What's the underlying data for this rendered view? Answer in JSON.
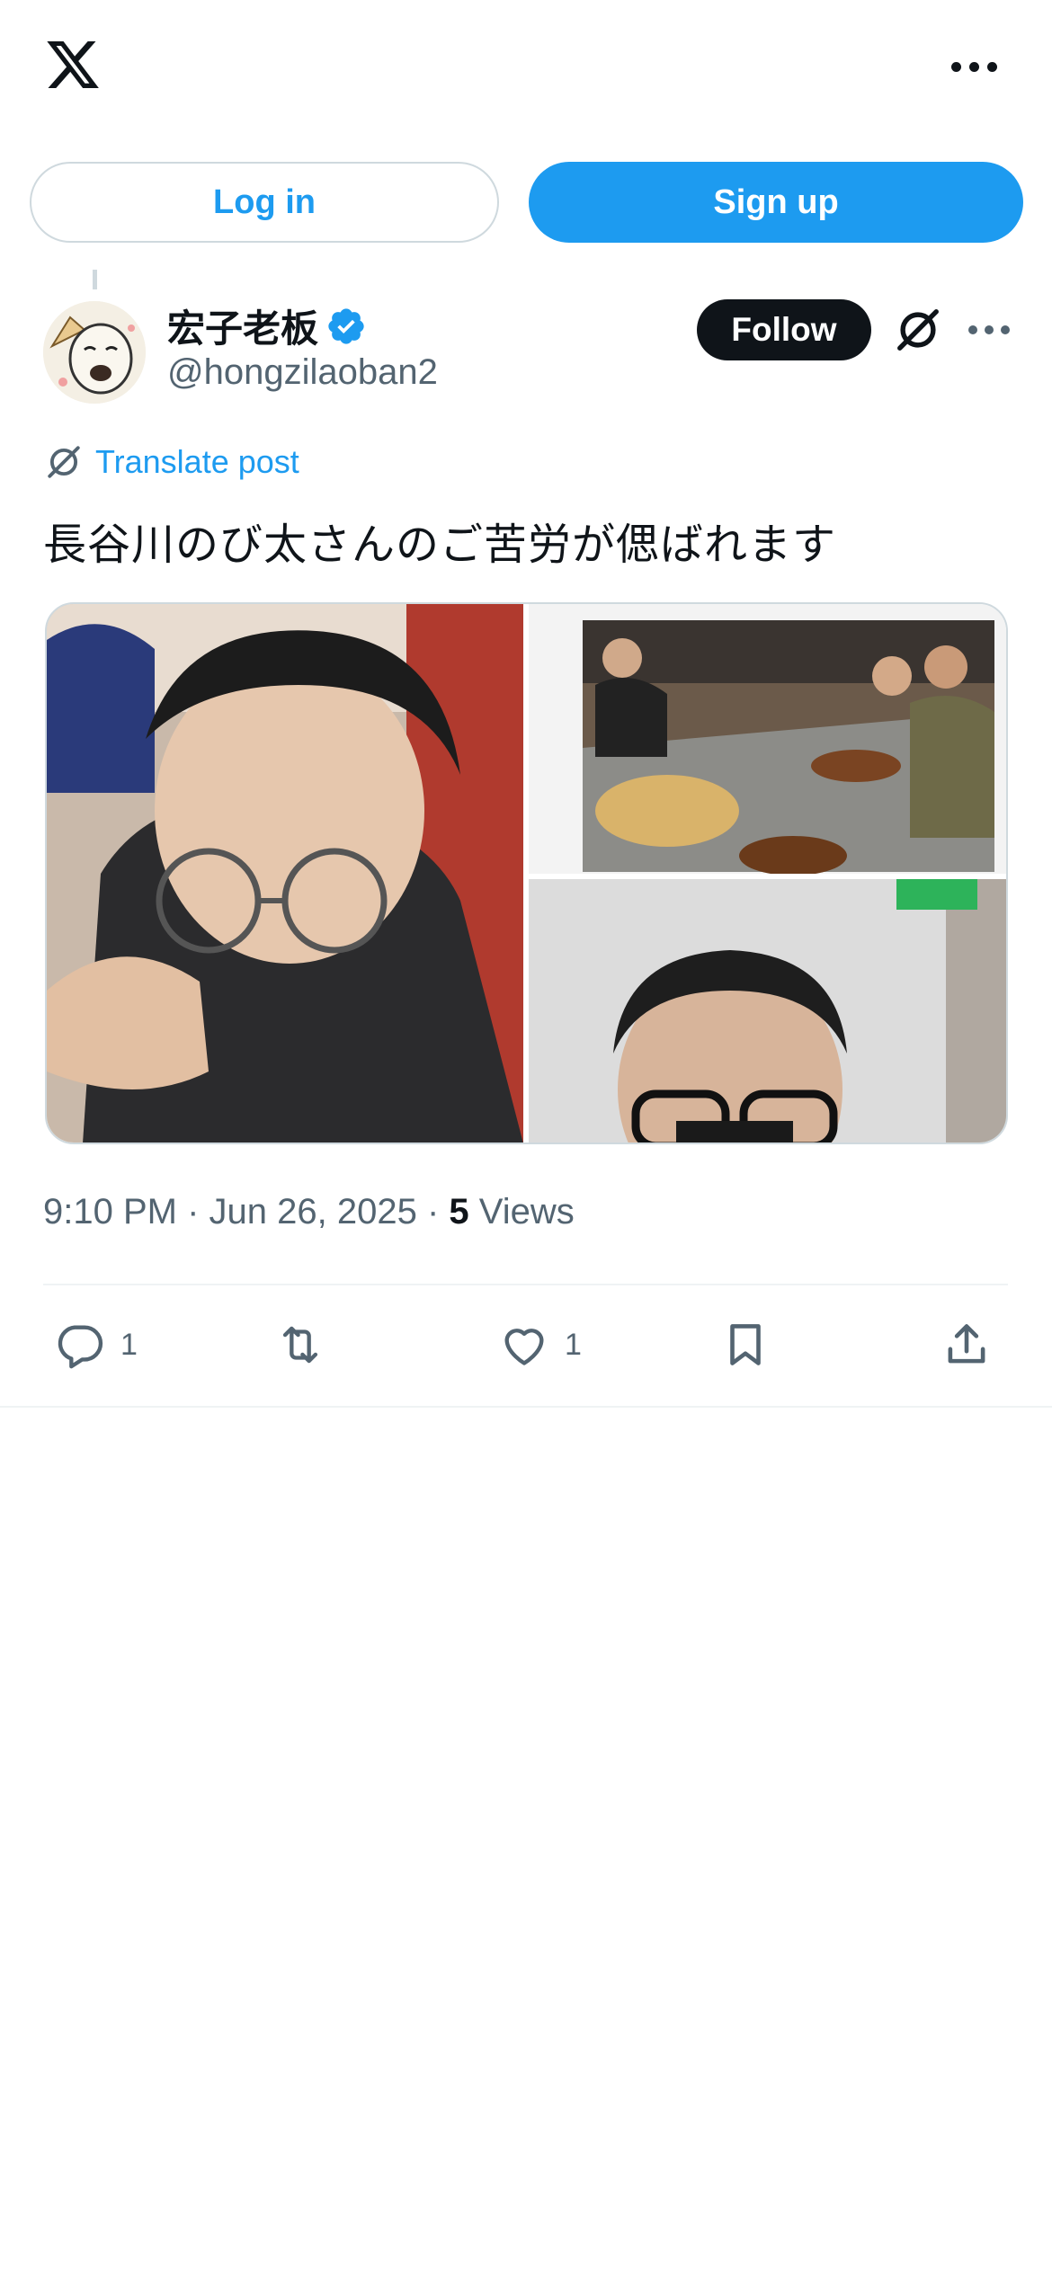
{
  "header": {
    "logo_icon": "x-logo-icon",
    "more_icon": "more-horizontal-icon"
  },
  "auth": {
    "login_label": "Log in",
    "signup_label": "Sign up"
  },
  "post": {
    "author": {
      "name": "宏子老板",
      "handle": "@hongzilaoban2",
      "verified": true
    },
    "follow_label": "Follow",
    "translate_label": "Translate post",
    "text": "長谷川のび太さんのご苦労が偲ばれます",
    "media_count": 3,
    "meta": {
      "time": "9:10 PM",
      "date": "Jun 26, 2025",
      "views_count": "5",
      "views_label": "Views"
    },
    "actions": {
      "replies": "1",
      "reposts": "",
      "likes": "1"
    }
  },
  "colors": {
    "accent": "#1d9bf0",
    "text_primary": "#0f1419",
    "text_secondary": "#536471",
    "border": "#cfd9de"
  }
}
